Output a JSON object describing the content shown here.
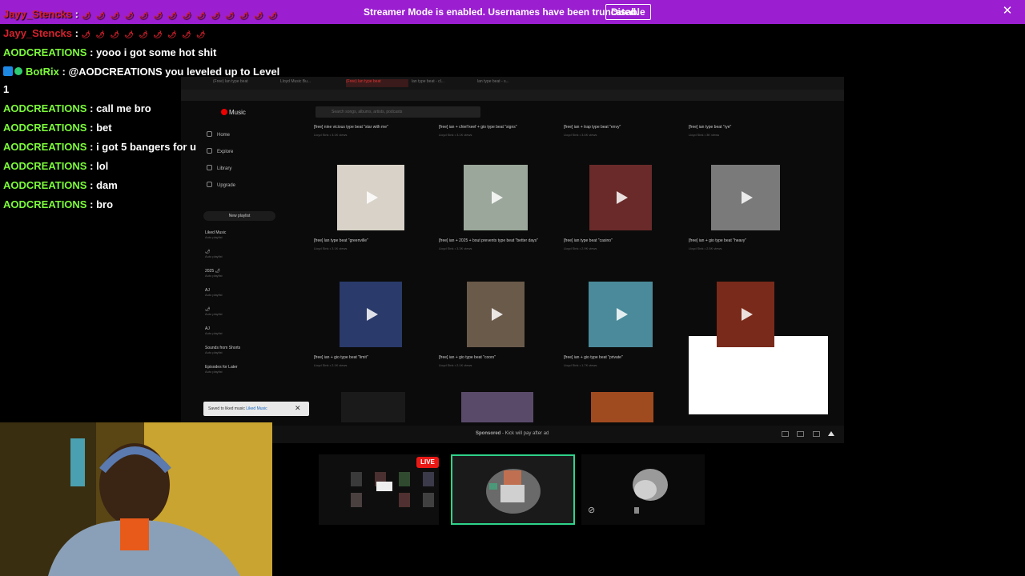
{
  "banner": {
    "message": "Streamer Mode is enabled. Usernames have been truncated.",
    "disable_label": "Disable",
    "close_symbol": "✕",
    "background": "#9b1fd1"
  },
  "chat": {
    "messages": [
      {
        "user": "Jayy_Stencks",
        "text": "",
        "emotes": "🌶 🌶 🌶 🌶 🌶 🌶 🌶 🌶 🌶 🌶 🌶 🌶 🌶 🌶",
        "user_color": "#d4212d"
      },
      {
        "user": "Jayy_Stencks",
        "text": "",
        "emotes": "🌶 🌶 🌶 🌶 🌶 🌶 🌶 🌶 🌶",
        "user_color": "#d4212d"
      },
      {
        "user": "AODCREATIONS",
        "text": "yooo i got some hot shit",
        "user_color": "#7cfc3a"
      },
      {
        "user": "BotRix",
        "text": "@AODCREATIONS you leveled up to Level",
        "user_color": "#7cfc3a"
      },
      {
        "user": "",
        "text": "1",
        "user_color": "#ffffff"
      },
      {
        "user": "AODCREATIONS",
        "text": "call me bro",
        "user_color": "#7cfc3a"
      },
      {
        "user": "AODCREATIONS",
        "text": "bet",
        "user_color": "#7cfc3a"
      },
      {
        "user": "AODCREATIONS",
        "text": "i got 5 bangers for u",
        "user_color": "#7cfc3a"
      },
      {
        "user": "AODCREATIONS",
        "text": "lol",
        "user_color": "#7cfc3a"
      },
      {
        "user": "AODCREATIONS",
        "text": "dam",
        "user_color": "#7cfc3a"
      },
      {
        "user": "AODCREATIONS",
        "text": "bro",
        "user_color": "#7cfc3a"
      }
    ],
    "separator": ":"
  },
  "screen_share": {
    "app_name": "Music",
    "search_placeholder": "Search songs, albums, artists, podcasts",
    "tabs": [
      "(Free) lan type beat",
      "Lloyd Music Bu...",
      "(Free) lan type beat",
      "lan type beat - cl...",
      "lan type beat - s..."
    ],
    "nav": [
      "Home",
      "Explore",
      "Library",
      "Upgrade"
    ],
    "new_playlist": "New playlist",
    "sidebar_playlists": [
      {
        "title": "Liked Music",
        "sub": "Auto playlist"
      },
      {
        "title": "🌶",
        "sub": "Auto playlist"
      },
      {
        "title": "2025 🌶",
        "sub": "Auto playlist"
      },
      {
        "title": "AJ",
        "sub": "Auto playlist"
      },
      {
        "title": "🌶",
        "sub": "Auto playlist"
      },
      {
        "title": "AJ",
        "sub": "Auto playlist"
      },
      {
        "title": "Sounds from Shorts",
        "sub": "Auto playlist"
      },
      {
        "title": "Episodes for Later",
        "sub": "Auto playlist"
      }
    ],
    "top_row": [
      {
        "title": "[free] nine vicious type beat \"star with me\"",
        "sub": "Lloyd Sink • 3.1K views"
      },
      {
        "title": "[free] ian + chief keef + gio type beat \"signs\"",
        "sub": "Lloyd Sink • 3.1K views"
      },
      {
        "title": "[free] ian + trap type beat \"envy\"",
        "sub": "Lloyd Sink • 3.4K views"
      },
      {
        "title": "[free] ian type beat \"rye\"",
        "sub": "Lloyd Sink • 3K views"
      }
    ],
    "row1": [
      {
        "title": "[free] lan type beat \"greenville\"",
        "sub": "Lloyd Sink • 3.1K views",
        "color": "#d8d2c8"
      },
      {
        "title": "[free] ian + 2025 + bout prevents type beat \"better days\"",
        "sub": "Lloyd Sink • 3.3K views",
        "color": "#9aa79a"
      },
      {
        "title": "[free] ian type beat \"casino\"",
        "sub": "Lloyd Sink • 2.9K views",
        "color": "#6a2a2a"
      },
      {
        "title": "[free] ian + gio type beat \"heavy\"",
        "sub": "Lloyd Sink • 2.5K views",
        "color": "#7a7a7a"
      }
    ],
    "row2": [
      {
        "title": "[free] ian + gio type beat \"limit\"",
        "sub": "Lloyd Sink • 2.1K views",
        "color": "#2a3a6a"
      },
      {
        "title": "[free] ian + gio type beat \"coors\"",
        "sub": "Lloyd Sink • 2.1K views",
        "color": "#6a5a4a"
      },
      {
        "title": "[free] ian + gio type beat \"private\"",
        "sub": "Lloyd Sink • 1.7K views",
        "color": "#4a8a9a"
      },
      {
        "title": "",
        "sub": "",
        "color": "#7a2a1a"
      }
    ],
    "toast_text": "Saved to liked music",
    "toast_link": "Liked Music"
  },
  "sponsored": {
    "label": "Sponsored",
    "text": "- Kick will pay after ad"
  },
  "stream_tiles": {
    "live_label": "LIVE"
  }
}
